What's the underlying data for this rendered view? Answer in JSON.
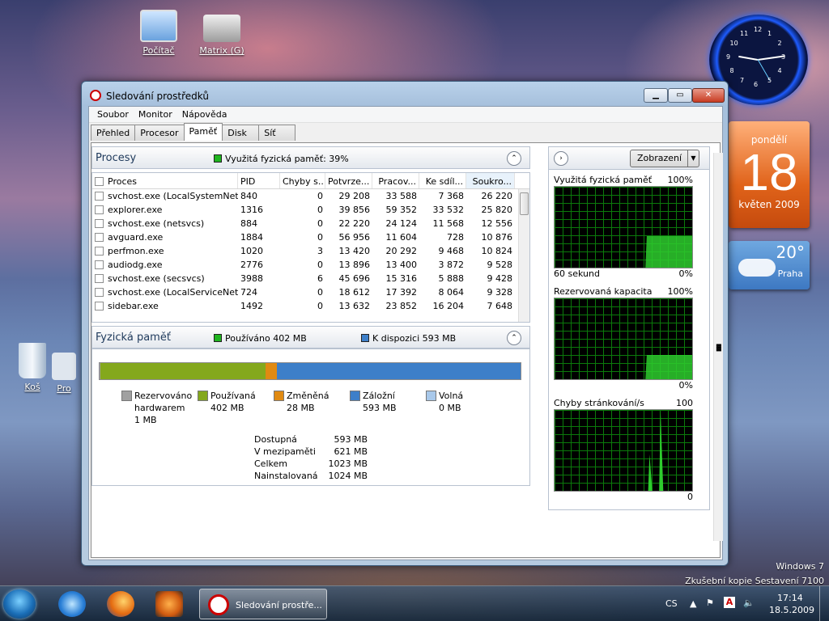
{
  "desktop": {
    "icons": [
      {
        "name": "computer",
        "label": "Počítač"
      },
      {
        "name": "drive",
        "label": "Matrix (G)"
      },
      {
        "name": "recycle-bin",
        "label": "Koš"
      },
      {
        "name": "partial",
        "label": "Pro"
      }
    ],
    "watermark_line1": "Windows 7",
    "watermark_line2": "Zkušební kopie Sestavení 7100"
  },
  "gadgets": {
    "clock_numbers": [
      "12",
      "1",
      "2",
      "3",
      "4",
      "5",
      "6",
      "7",
      "8",
      "9",
      "10",
      "11"
    ],
    "calendar": {
      "day": "pondělí",
      "date": "18",
      "month": "květen 2009"
    },
    "weather": {
      "temp": "20°",
      "city": "Praha"
    }
  },
  "window": {
    "title": "Sledování prostředků",
    "menu": [
      "Soubor",
      "Monitor",
      "Nápověda"
    ],
    "tabs": [
      "Přehled",
      "Procesor",
      "Paměť",
      "Disk",
      "Síť"
    ],
    "active_tab": "Paměť",
    "processes": {
      "title": "Procesy",
      "summary": "Využitá fyzická paměť: 39%",
      "headers": [
        "Proces",
        "PID",
        "Chyby s...",
        "Potvrze...",
        "Pracov...",
        "Ke sdíl...",
        "Soukro..."
      ],
      "rows": [
        [
          "svchost.exe (LocalSystemNet...",
          "840",
          "0",
          "29 208",
          "33 588",
          "7 368",
          "26 220"
        ],
        [
          "explorer.exe",
          "1316",
          "0",
          "39 856",
          "59 352",
          "33 532",
          "25 820"
        ],
        [
          "svchost.exe (netsvcs)",
          "884",
          "0",
          "22 220",
          "24 124",
          "11 568",
          "12 556"
        ],
        [
          "avguard.exe",
          "1884",
          "0",
          "56 956",
          "11 604",
          "728",
          "10 876"
        ],
        [
          "perfmon.exe",
          "1020",
          "3",
          "13 420",
          "20 292",
          "9 468",
          "10 824"
        ],
        [
          "audiodg.exe",
          "2776",
          "0",
          "13 896",
          "13 400",
          "3 872",
          "9 528"
        ],
        [
          "svchost.exe (secsvcs)",
          "3988",
          "6",
          "45 696",
          "15 316",
          "5 888",
          "9 428"
        ],
        [
          "svchost.exe (LocalServiceNet...",
          "724",
          "0",
          "18 612",
          "17 392",
          "8 064",
          "9 328"
        ],
        [
          "sidebar.exe",
          "1492",
          "0",
          "13 632",
          "23 852",
          "16 204",
          "7 648"
        ]
      ]
    },
    "physical_memory": {
      "title": "Fyzická paměť",
      "used_summary": "Používáno 402 MB",
      "available_summary": "K dispozici 593 MB",
      "bar": {
        "reserved": 1,
        "used": 402,
        "modified": 28,
        "standby": 593,
        "free": 0,
        "total": 1024
      },
      "legend": [
        {
          "label": "Rezervováno hardwarem",
          "value": "1 MB",
          "color": "#a0a0a0"
        },
        {
          "label": "Používaná",
          "value": "402 MB",
          "color": "#84a81c"
        },
        {
          "label": "Změněná",
          "value": "28 MB",
          "color": "#e08a12"
        },
        {
          "label": "Záložní",
          "value": "593 MB",
          "color": "#3d7fc9"
        },
        {
          "label": "Volná",
          "value": "0 MB",
          "color": "#a8c8ea"
        }
      ],
      "stats": [
        {
          "k": "Dostupná",
          "v": "593 MB"
        },
        {
          "k": "V mezipaměti",
          "v": "621 MB"
        },
        {
          "k": "Celkem",
          "v": "1023 MB"
        },
        {
          "k": "Nainstalovaná",
          "v": "1024 MB"
        }
      ]
    },
    "right_pane": {
      "view_button": "Zobrazení",
      "graphs": [
        {
          "title": "Využitá fyzická paměť",
          "max": "100%",
          "foot_left": "60 sekund",
          "foot_right": "0%",
          "level": 0.39
        },
        {
          "title": "Rezervovaná kapacita",
          "max": "100%",
          "foot_left": "",
          "foot_right": "0%",
          "level": 0.3
        },
        {
          "title": "Chyby stránkování/s",
          "max": "100",
          "foot_left": "",
          "foot_right": "0",
          "level": 0.2
        }
      ]
    }
  },
  "taskbar": {
    "task_label": "Sledování prostře...",
    "lang": "CS",
    "time": "17:14",
    "date": "18.5.2009"
  }
}
